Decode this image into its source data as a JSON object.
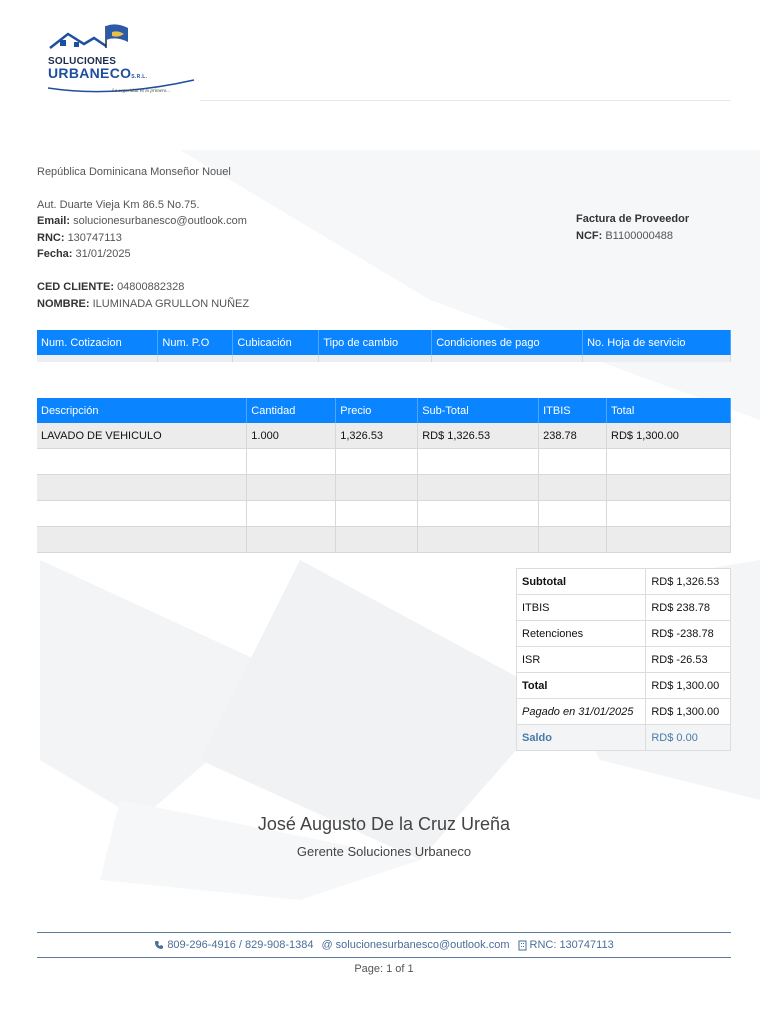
{
  "company": {
    "logo_word1": "SOLUCIONES",
    "logo_word2": "URBANECO",
    "logo_suffix": "S.R.L.",
    "tagline": "La seguridad es lo primero...",
    "location": "República Dominicana Monseñor Nouel",
    "address": "Aut. Duarte Vieja Km 86.5 No.75.",
    "email_label": "Email:",
    "email": "solucionesurbanesco@outlook.com",
    "rnc_label": "RNC:",
    "rnc": "130747113",
    "date_label": "Fecha:",
    "date": "31/01/2025"
  },
  "invoice": {
    "type": "Factura de Proveedor",
    "ncf_label": "NCF:",
    "ncf": "B1100000488"
  },
  "client": {
    "ced_label": "CED CLIENTE:",
    "ced": "04800882328",
    "name_label": "NOMBRE:",
    "name": "ILUMINADA GRULLON NUÑEZ"
  },
  "service_table": {
    "headers": [
      "Num. Cotizacion",
      "Num. P.O",
      "Cubicación",
      "Tipo de cambio",
      "Condiciones de pago",
      "No. Hoja de servicio"
    ]
  },
  "items_table": {
    "headers": [
      "Descripción",
      "Cantidad",
      "Precio",
      "Sub-Total",
      "ITBIS",
      "Total"
    ],
    "rows": [
      [
        "LAVADO DE VEHICULO",
        "1.000",
        "1,326.53",
        "RD$ 1,326.53",
        "238.78",
        "RD$ 1,300.00"
      ]
    ]
  },
  "totals": [
    {
      "label": "Subtotal",
      "value": "RD$ 1,326.53"
    },
    {
      "label": "ITBIS",
      "value": "RD$ 238.78"
    },
    {
      "label": "Retenciones",
      "value": "RD$ -238.78"
    },
    {
      "label": "ISR",
      "value": "RD$ -26.53"
    },
    {
      "label": "Total",
      "value": "RD$ 1,300.00"
    },
    {
      "label": "Pagado en 31/01/2025",
      "value": "RD$ 1,300.00"
    },
    {
      "label": "Saldo",
      "value": "RD$ 0.00"
    }
  ],
  "signature": {
    "name": "José Augusto De la Cruz Ureña",
    "title": "Gerente Soluciones Urbaneco"
  },
  "footer": {
    "phones": "809-296-4916 / 829-908-1384",
    "email": "solucionesurbanesco@outlook.com",
    "rnc": "RNC: 130747113",
    "page": "Page: 1 of 1"
  },
  "colors": {
    "header_blue": "#0a84ff",
    "brand_blue": "#1d4f9e",
    "footer_blue": "#4a6e96"
  }
}
